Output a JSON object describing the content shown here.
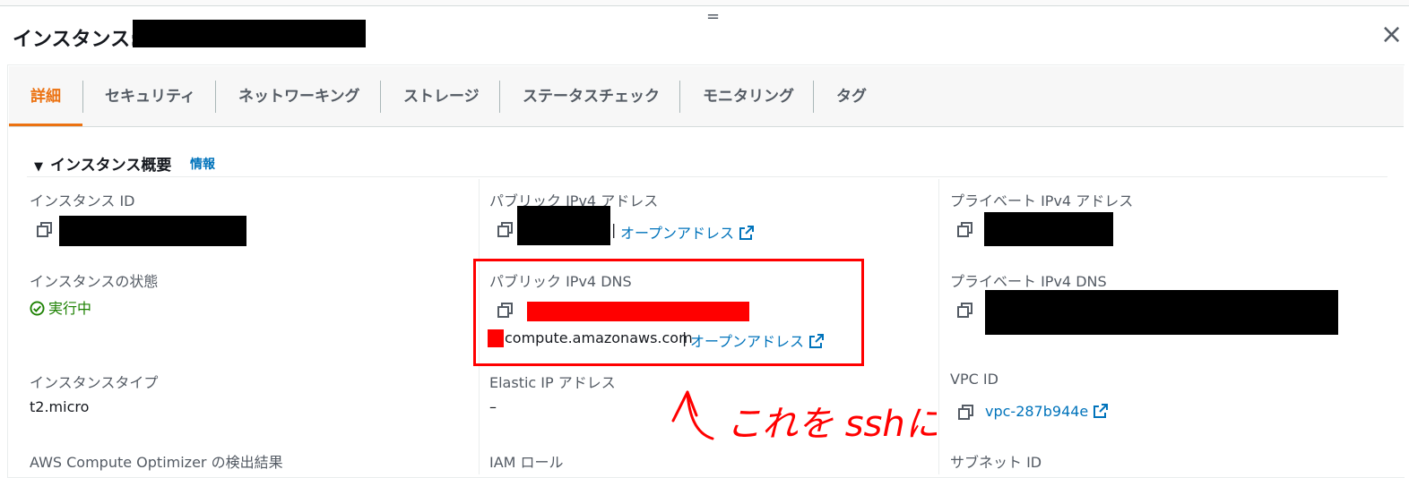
{
  "header": {
    "title": "インスタンス:",
    "grip": "=",
    "close_icon": "close-icon"
  },
  "tabs": [
    {
      "label": "詳細",
      "active": true
    },
    {
      "label": "セキュリティ",
      "active": false
    },
    {
      "label": "ネットワーキング",
      "active": false
    },
    {
      "label": "ストレージ",
      "active": false
    },
    {
      "label": "ステータスチェック",
      "active": false
    },
    {
      "label": "モニタリング",
      "active": false
    },
    {
      "label": "タグ",
      "active": false
    }
  ],
  "summary": {
    "heading": "インスタンス概要",
    "info_link": "情報",
    "fields": {
      "instance_id_label": "インスタンス ID",
      "public_ipv4_label": "パブリック IPv4 アドレス",
      "private_ipv4_label": "プライベート IPv4 アドレス",
      "state_label": "インスタンスの状態",
      "state_value": "実行中",
      "public_dns_label": "パブリック IPv4 DNS",
      "public_dns_value_suffix": "compute.amazonaws.com",
      "private_dns_label": "プライベート IPv4 DNS",
      "instance_type_label": "インスタンスタイプ",
      "instance_type_value": "t2.micro",
      "elastic_ip_label": "Elastic IP アドレス",
      "elastic_ip_value": "–",
      "vpc_label": "VPC ID",
      "vpc_value": "vpc-287b944e",
      "optimizer_label": "AWS Compute Optimizer の検出結果",
      "iam_label": "IAM ロール",
      "subnet_label": "サブネット ID",
      "open_address_link": "オープンアドレス",
      "separator": "|"
    }
  },
  "annotation": {
    "handwritten_text": "これを sshに"
  },
  "colors": {
    "accent_orange": "#ec7211",
    "link_blue": "#0073bb",
    "status_green": "#1d8102",
    "annotation_red": "#ff0000"
  }
}
